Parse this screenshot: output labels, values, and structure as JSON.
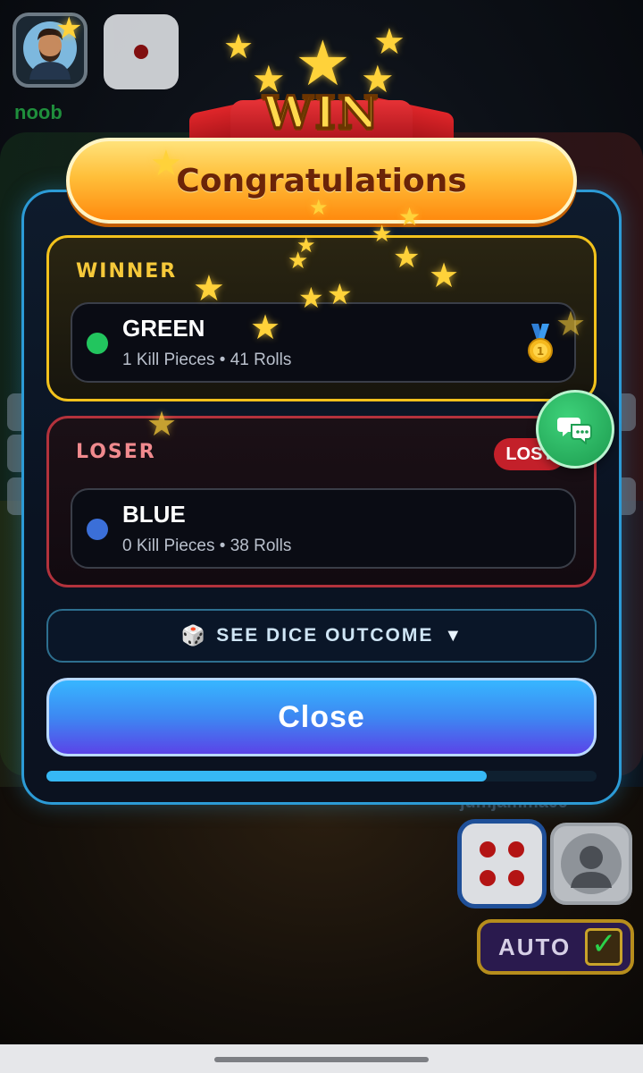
{
  "players": {
    "top_left_name": "noob",
    "bottom_right_name": "jumjamma09"
  },
  "auto": {
    "label": "AUTO",
    "checked": true
  },
  "banner": {
    "text": "WIN"
  },
  "modal": {
    "title": "Congratulations",
    "winner": {
      "section_label": "WINNER",
      "color_name": "GREEN",
      "dot_color": "#22c55e",
      "stats": "1 Kill Pieces • 41 Rolls",
      "medal_icon": "gold-medal-icon"
    },
    "loser": {
      "section_label": "LOSER",
      "badge": "LOST",
      "color_name": "BLUE",
      "dot_color": "#3b6fd8",
      "stats": "0 Kill Pieces • 38 Rolls"
    },
    "dice_outcome": {
      "icon": "🎲",
      "label": "SEE DICE OUTCOME",
      "arrow": "▼"
    },
    "close_label": "Close",
    "progress": 0.8
  },
  "colors": {
    "accent_blue": "#2c9bd6",
    "winner_border": "#f2c21c",
    "loser_border": "#b3323c",
    "chat_green": "#1c9a4e"
  }
}
